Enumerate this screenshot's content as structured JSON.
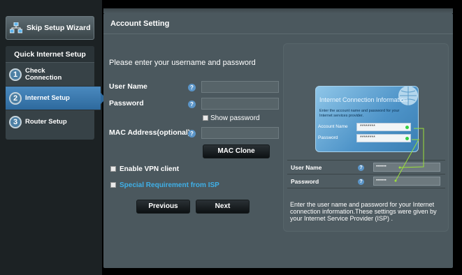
{
  "sidebar": {
    "skip_label": "Skip Setup Wizard",
    "qis_title": "Quick Internet Setup",
    "steps": [
      {
        "num": "1",
        "label": "Check Connection"
      },
      {
        "num": "2",
        "label": "Internet Setup"
      },
      {
        "num": "3",
        "label": "Router Setup"
      }
    ]
  },
  "main": {
    "title": "Account Setting",
    "intro": "Please enter your username and password",
    "username_label": "User Name",
    "password_label": "Password",
    "show_password_label": "Show password",
    "mac_label": "MAC Address(optional)",
    "mac_clone_label": "MAC Clone",
    "vpn_label": "Enable VPN client",
    "special_label": "Special Requirement from ISP",
    "previous_label": "Previous",
    "next_label": "Next",
    "help_glyph": "?"
  },
  "illustration": {
    "card_title": "Internet Connection Information",
    "card_desc": "Enter the account name and password for your Internet services provider.",
    "account_label": "Account Name",
    "account_value": "********",
    "password_label": "Password",
    "password_value": "********",
    "user_name_label": "User Name",
    "user_name_value": "•••••••",
    "password2_label": "Password",
    "password2_value": "•••••••",
    "note": "Enter the user name and password for your Internet connection information.These settings were given by your Internet Service Provider (ISP) ."
  },
  "colors": {
    "accent_blue": "#2e6a9e",
    "link": "#3fb0e8",
    "panel": "#4b585e",
    "indicator_green": "#35d044",
    "connector_line": "#9be03a"
  },
  "icons": {
    "skip": "network-icon",
    "help": "question-mark-icon",
    "globe": "globe-icon"
  }
}
